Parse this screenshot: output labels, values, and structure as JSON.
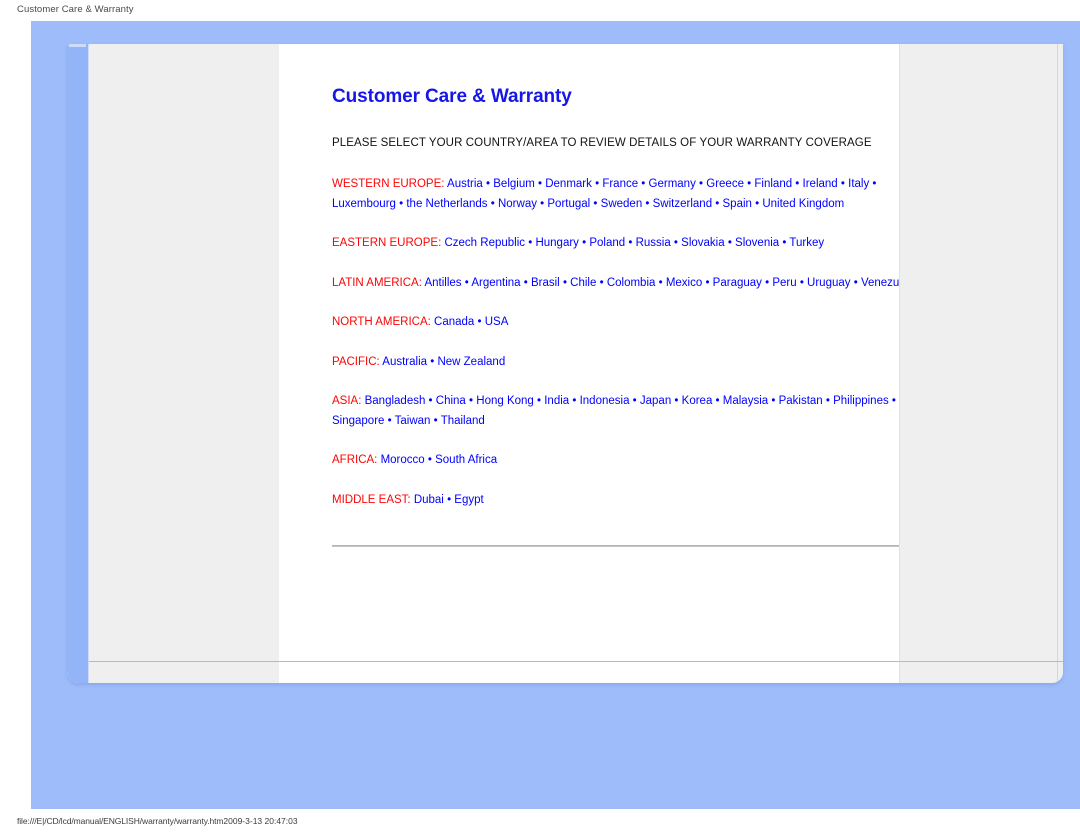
{
  "browser": {
    "header_title": "Customer Care & Warranty",
    "footer_url": "file:///E|/CD/lcd/manual/ENGLISH/warranty/warranty.htm",
    "footer_timestamp": "2009-3-13 20:47:03"
  },
  "colors": {
    "title_blue": "#1616e8",
    "link_blue": "#0000ff",
    "region_red": "#fb0505",
    "page_blue": "#9dbcf9",
    "gutter_grey": "#efefef",
    "rule_grey": "#c4c4c4"
  },
  "document": {
    "title": "Customer Care & Warranty",
    "intro": "PLEASE SELECT YOUR COUNTRY/AREA TO REVIEW DETAILS OF YOUR WARRANTY COVERAGE",
    "separator": " • ",
    "regions": [
      {
        "label": "WESTERN EUROPE:",
        "countries": [
          "Austria",
          "Belgium",
          "Denmark",
          "France",
          "Germany",
          "Greece",
          "Finland",
          "Ireland",
          "Italy",
          "Luxembourg",
          "the Netherlands",
          "Norway",
          "Portugal",
          "Sweden",
          "Switzerland",
          "Spain",
          "United Kingdom"
        ]
      },
      {
        "label": "EASTERN EUROPE:",
        "countries": [
          "Czech Republic",
          "Hungary",
          "Poland",
          "Russia",
          "Slovakia",
          "Slovenia",
          "Turkey"
        ]
      },
      {
        "label": "LATIN AMERICA:",
        "countries": [
          "Antilles",
          "Argentina",
          "Brasil",
          "Chile",
          "Colombia",
          "Mexico",
          "Paraguay",
          "Peru",
          "Uruguay",
          "Venezuela"
        ]
      },
      {
        "label": "NORTH AMERICA:",
        "countries": [
          "Canada",
          "USA"
        ]
      },
      {
        "label": "PACIFIC:",
        "countries": [
          "Australia",
          "New Zealand"
        ]
      },
      {
        "label": "ASIA:",
        "countries": [
          "Bangladesh",
          "China",
          "Hong Kong",
          "India",
          "Indonesia",
          "Japan",
          "Korea",
          "Malaysia",
          "Pakistan",
          "Philippines",
          "Singapore",
          "Taiwan",
          "Thailand"
        ]
      },
      {
        "label": "AFRICA:",
        "countries": [
          "Morocco",
          "South Africa"
        ]
      },
      {
        "label": "MIDDLE EAST:",
        "countries": [
          "Dubai",
          "Egypt"
        ]
      }
    ]
  }
}
